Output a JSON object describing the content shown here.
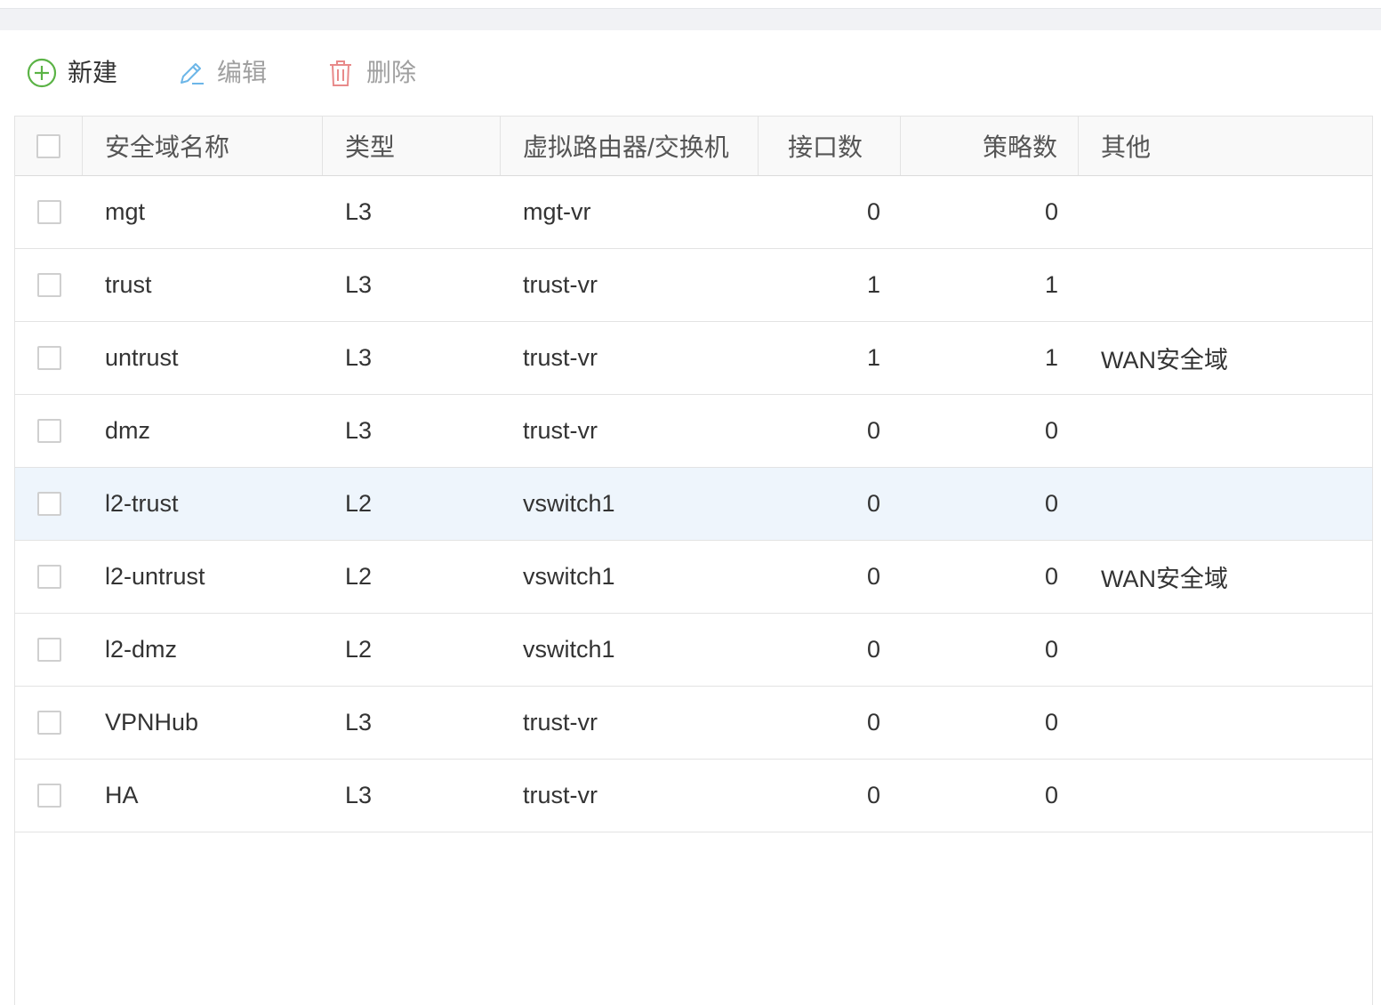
{
  "toolbar": {
    "new_label": "新建",
    "edit_label": "编辑",
    "delete_label": "删除",
    "new_icon": "plus-circle-icon",
    "edit_icon": "pencil-icon",
    "delete_icon": "trash-icon",
    "new_color": "#5bb346",
    "edit_color": "#6cb6e8",
    "delete_color": "#e88a8a"
  },
  "table": {
    "columns": {
      "name": "安全域名称",
      "type": "类型",
      "vr": "虚拟路由器/交换机",
      "interfaces": "接口数",
      "policies": "策略数",
      "other": "其他"
    },
    "rows": [
      {
        "name": "mgt",
        "type": "L3",
        "vr": "mgt-vr",
        "interfaces": "0",
        "policies": "0",
        "other": ""
      },
      {
        "name": "trust",
        "type": "L3",
        "vr": "trust-vr",
        "interfaces": "1",
        "policies": "1",
        "other": ""
      },
      {
        "name": "untrust",
        "type": "L3",
        "vr": "trust-vr",
        "interfaces": "1",
        "policies": "1",
        "other": "WAN安全域"
      },
      {
        "name": "dmz",
        "type": "L3",
        "vr": "trust-vr",
        "interfaces": "0",
        "policies": "0",
        "other": ""
      },
      {
        "name": "l2-trust",
        "type": "L2",
        "vr": "vswitch1",
        "interfaces": "0",
        "policies": "0",
        "other": ""
      },
      {
        "name": "l2-untrust",
        "type": "L2",
        "vr": "vswitch1",
        "interfaces": "0",
        "policies": "0",
        "other": "WAN安全域"
      },
      {
        "name": "l2-dmz",
        "type": "L2",
        "vr": "vswitch1",
        "interfaces": "0",
        "policies": "0",
        "other": ""
      },
      {
        "name": "VPNHub",
        "type": "L3",
        "vr": "trust-vr",
        "interfaces": "0",
        "policies": "0",
        "other": ""
      },
      {
        "name": "HA",
        "type": "L3",
        "vr": "trust-vr",
        "interfaces": "0",
        "policies": "0",
        "other": ""
      }
    ],
    "highlight_color": "#eef5fc"
  }
}
